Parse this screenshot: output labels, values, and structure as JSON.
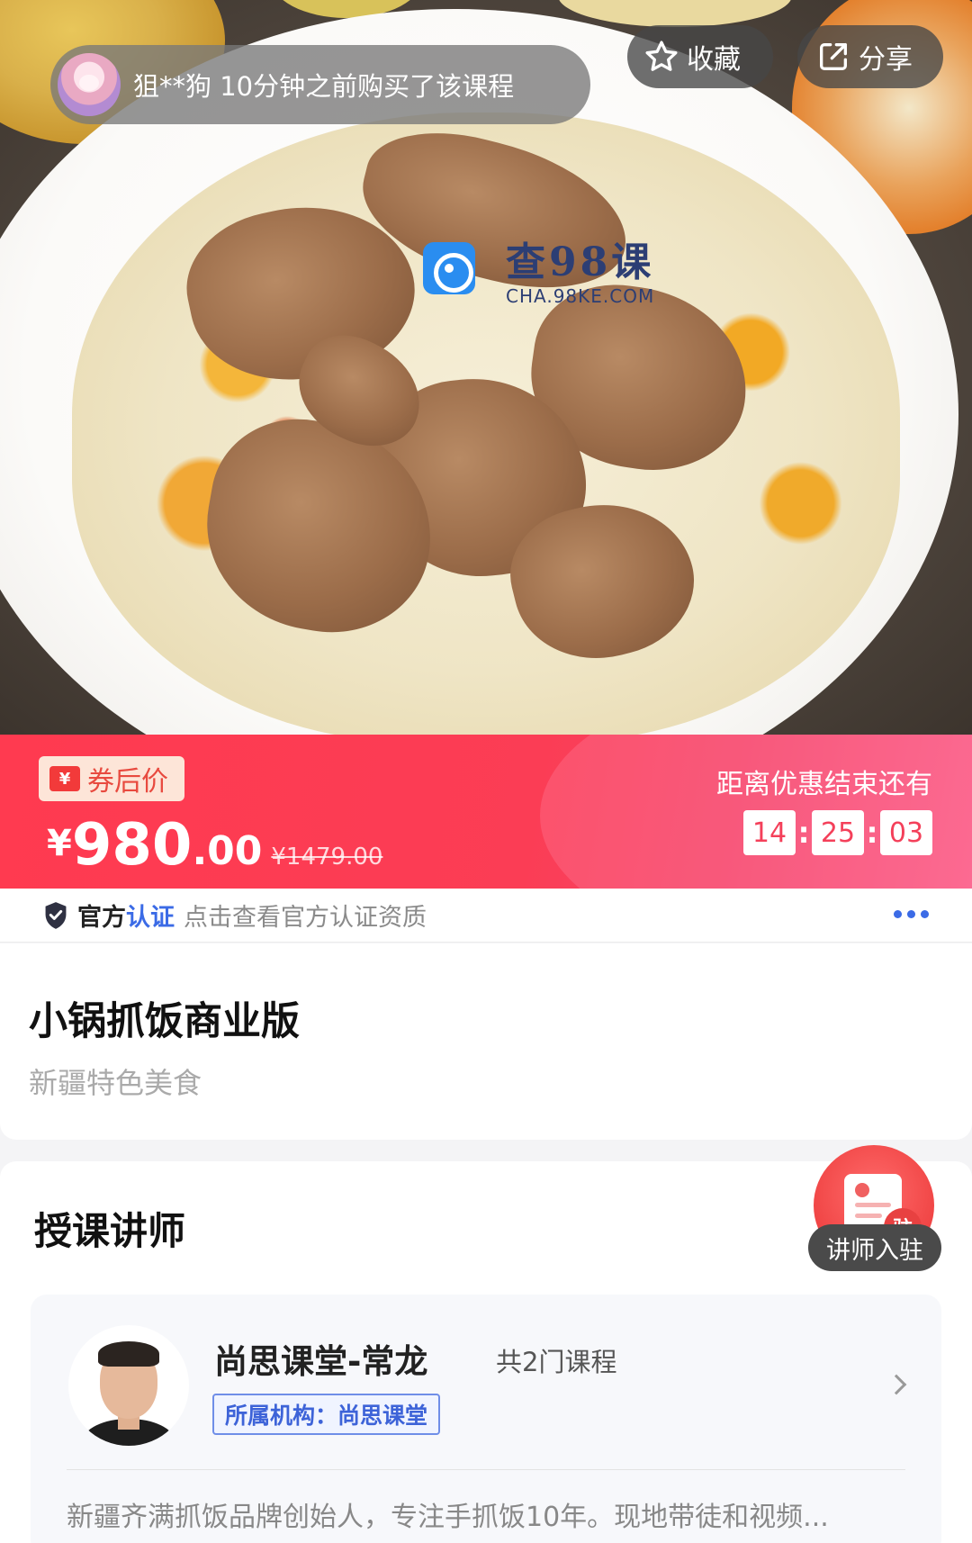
{
  "hero": {
    "notice_text": "狙**狗 10分钟之前购买了该课程",
    "favorite_label": "收藏",
    "share_label": "分享",
    "watermark_title": "查98课",
    "watermark_subtitle": "CHA.98KE.COM"
  },
  "price": {
    "coupon_icon": "¥",
    "coupon_label": "券后价",
    "currency": "¥",
    "integer": "980",
    "decimal": ".00",
    "original": "¥1479.00",
    "countdown_label": "距离优惠结束还有",
    "countdown": {
      "hours": "14",
      "minutes": "25",
      "seconds": "03"
    },
    "accent_color": "#ff3a50"
  },
  "official": {
    "label_a": "官方",
    "label_b": "认证",
    "link_text": "点击查看官方认证资质"
  },
  "course": {
    "title": "小锅抓饭商业版",
    "subtitle": "新疆特色美食"
  },
  "teacher_section": {
    "title": "授课讲师",
    "fab_badge": "驻",
    "fab_label": "讲师入驻",
    "teacher": {
      "name": "尚思课堂-常龙",
      "course_count": "共2门课程",
      "org_tag": "所属机构：尚思课堂",
      "description": "新疆齐满抓饭品牌创始人，专注手抓饭10年。现地带徒和视频..."
    }
  },
  "icons": {
    "favorite": "star-icon",
    "share": "share-icon",
    "official": "shield-check-icon",
    "more": "more-dots-icon",
    "chevron": "chevron-right-icon"
  }
}
